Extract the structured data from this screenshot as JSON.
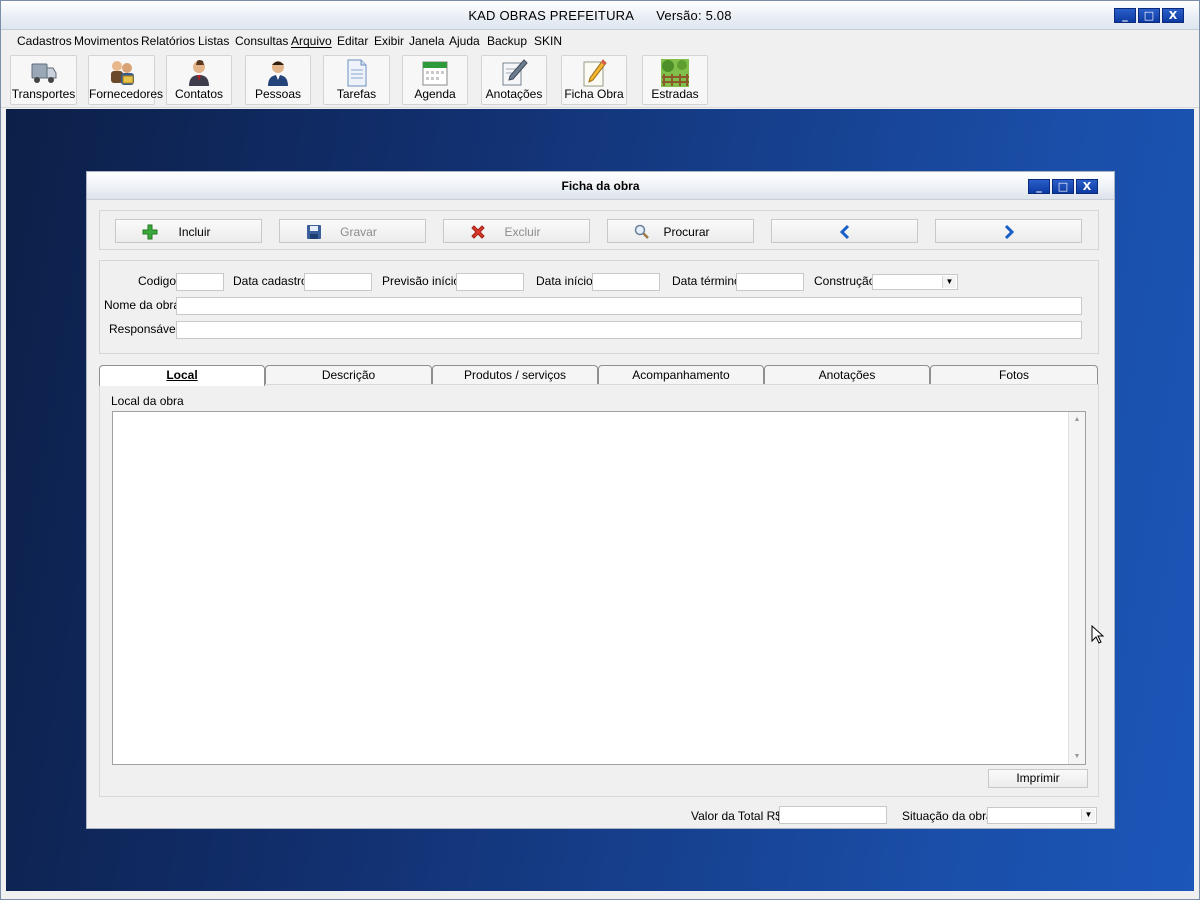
{
  "app": {
    "title": "KAD OBRAS PREFEITURA      Versão: 5.08",
    "window_controls": [
      "_",
      "□",
      "X"
    ]
  },
  "menu": [
    "Cadastros",
    "Movimentos",
    "Relatórios",
    "Listas",
    "Consultas",
    "Arquivo",
    "Editar",
    "Exibir",
    "Janela",
    "Ajuda",
    "Backup",
    "SKIN"
  ],
  "toolbar": [
    {
      "label": "Transportes",
      "icon": "truck-icon"
    },
    {
      "label": "Fornecedores",
      "icon": "suppliers-icon"
    },
    {
      "label": "Contatos",
      "icon": "contact-person-icon"
    },
    {
      "label": "Pessoas",
      "icon": "person-icon"
    },
    {
      "label": "Tarefas",
      "icon": "document-icon"
    },
    {
      "label": "Agenda",
      "icon": "calendar-icon"
    },
    {
      "label": "Anotações",
      "icon": "notes-pen-icon"
    },
    {
      "label": "Ficha Obra",
      "icon": "pencil-sheet-icon"
    },
    {
      "label": "Estradas",
      "icon": "road-fence-icon"
    }
  ],
  "child_window": {
    "title": "Ficha da obra",
    "actions": [
      {
        "label": "Incluir",
        "icon": "plus-icon",
        "enabled": true
      },
      {
        "label": "Gravar",
        "icon": "save-icon",
        "enabled": false
      },
      {
        "label": "Excluir",
        "icon": "delete-x-icon",
        "enabled": false
      },
      {
        "label": "Procurar",
        "icon": "magnifier-icon",
        "enabled": true
      },
      {
        "label": "",
        "icon": "arrow-left-icon",
        "enabled": true
      },
      {
        "label": "",
        "icon": "arrow-right-icon",
        "enabled": true
      }
    ],
    "fields": {
      "codigo": {
        "label": "Codigo",
        "value": ""
      },
      "data_cadastro": {
        "label": "Data cadastro",
        "value": ""
      },
      "previsao_inicio": {
        "label": "Previsão início",
        "value": ""
      },
      "data_inicio": {
        "label": "Data início",
        "value": ""
      },
      "data_termino": {
        "label": "Data término",
        "value": ""
      },
      "construcao": {
        "label": "Construção",
        "value": ""
      },
      "nome_obra": {
        "label": "Nome da obra",
        "value": ""
      },
      "responsavel": {
        "label": "Responsável",
        "value": ""
      }
    },
    "tabs": [
      "Local",
      "Descrição",
      "Produtos / serviços",
      "Acompanhamento",
      "Anotações",
      "Fotos"
    ],
    "active_tab": "Local",
    "local_label": "Local da obra",
    "local_value": "",
    "print_label": "Imprimir",
    "footer": {
      "valor_total_label": "Valor da Total R$",
      "valor_total_value": "",
      "situacao_label": "Situação da obra",
      "situacao_value": ""
    }
  },
  "colors": {
    "desktop_dark": "#0c1f47",
    "desktop_light": "#1b56b8",
    "window_button": "#0d3aa3",
    "nav_arrow": "#1a5fc8"
  }
}
